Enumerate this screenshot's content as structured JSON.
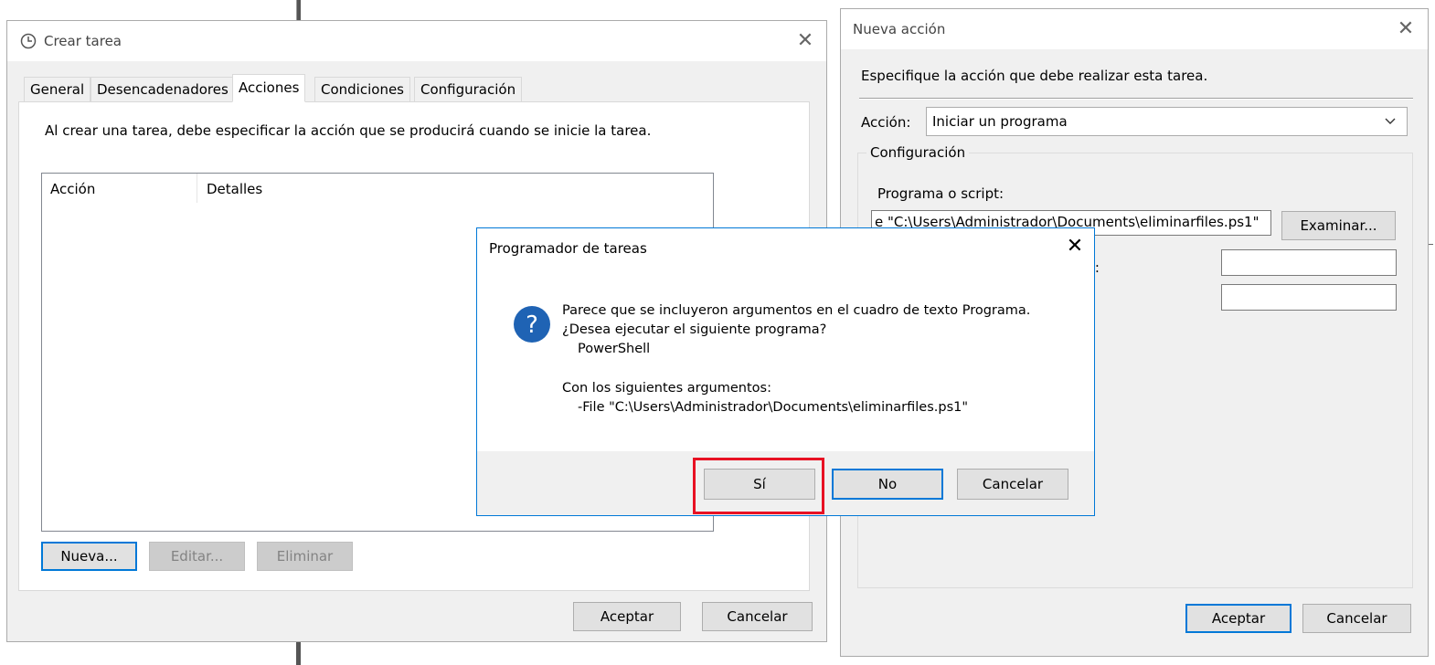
{
  "crear_tarea": {
    "title": "Crear tarea",
    "tabs": [
      "General",
      "Desencadenadores",
      "Acciones",
      "Condiciones",
      "Configuración"
    ],
    "active_tab": "Acciones",
    "intro_text": "Al crear una tarea, debe especificar la acción que se producirá cuando se inicie la tarea.",
    "table_headers": [
      "Acción",
      "Detalles"
    ],
    "buttons": {
      "new": "Nueva...",
      "edit": "Editar...",
      "delete": "Eliminar",
      "ok": "Aceptar",
      "cancel": "Cancelar"
    }
  },
  "nueva_accion": {
    "title": "Nueva acción",
    "instruction": "Especifique la acción que debe realizar esta tarea.",
    "action_label": "Acción:",
    "action_value": "Iniciar un programa",
    "group_label": "Configuración",
    "program_label": "Programa o script:",
    "program_value": "e \"C:\\Users\\Administrador\\Documents\\eliminarfiles.ps1\"",
    "browse_label": "Examinar...",
    "partial_label": "):",
    "ok_label": "Aceptar",
    "cancel_label": "Cancelar"
  },
  "dialog": {
    "title": "Programador de tareas",
    "icon": "question-icon",
    "line1": "Parece que se incluyeron argumentos en el cuadro de texto Programa.",
    "line2": "¿Desea ejecutar el siguiente programa?",
    "program": "PowerShell",
    "args_label": "Con los siguientes argumentos:",
    "args_value": "-File \"C:\\Users\\Administrador\\Documents\\eliminarfiles.ps1\"",
    "yes_label": "Sí",
    "no_label": "No",
    "cancel_label": "Cancelar"
  },
  "colors": {
    "accent": "#0078d7",
    "highlight": "#e81123"
  }
}
